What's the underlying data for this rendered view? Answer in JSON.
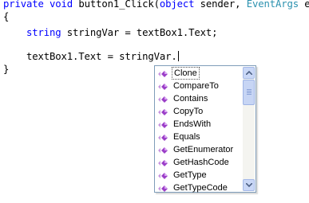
{
  "editor": {
    "line1": {
      "kw_private": "private",
      "kw_void": "void",
      "method_sig": " button1_Click(",
      "kw_object": "object",
      "sender_param": " sender, ",
      "type_eventargs": "EventArgs",
      "e_param": " e)"
    },
    "line2": "{",
    "line3": {
      "kw_string": "string",
      "rest": " stringVar = textBox1.Text;"
    },
    "line5": "textBox1.Text = stringVar.",
    "line6": "}"
  },
  "intellisense": {
    "items": [
      {
        "label": "Clone",
        "icon": "method-icon"
      },
      {
        "label": "CompareTo",
        "icon": "method-icon"
      },
      {
        "label": "Contains",
        "icon": "method-icon"
      },
      {
        "label": "CopyTo",
        "icon": "method-icon"
      },
      {
        "label": "EndsWith",
        "icon": "method-icon"
      },
      {
        "label": "Equals",
        "icon": "method-icon"
      },
      {
        "label": "GetEnumerator",
        "icon": "method-icon"
      },
      {
        "label": "GetHashCode",
        "icon": "method-icon"
      },
      {
        "label": "GetType",
        "icon": "method-icon"
      },
      {
        "label": "GetTypeCode",
        "icon": "method-icon"
      }
    ],
    "selected_index": 0
  },
  "colors": {
    "keyword": "#0000ff",
    "type": "#2b91af",
    "method_icon": "#9b3fc8"
  }
}
